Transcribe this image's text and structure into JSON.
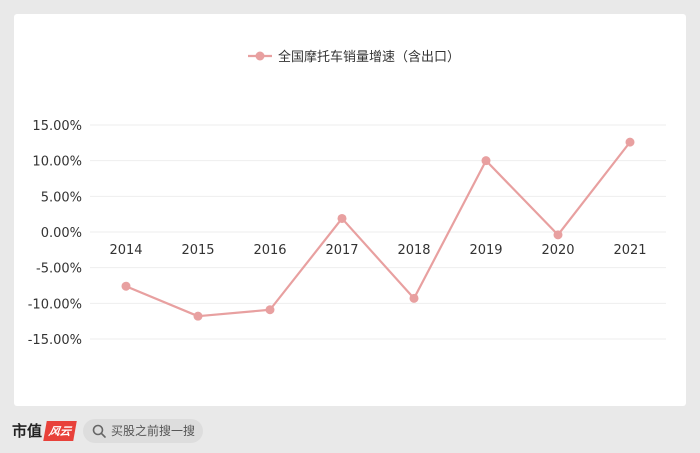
{
  "chart_data": {
    "type": "line",
    "x": [
      "2014",
      "2015",
      "2016",
      "2017",
      "2018",
      "2019",
      "2020",
      "2021"
    ],
    "series": [
      {
        "name": "全国摩托车销量增速（含出口）",
        "values": [
          -7.6,
          -11.8,
          -10.9,
          1.9,
          -9.3,
          10.0,
          -0.4,
          12.6
        ],
        "color": "#e8a0a0"
      }
    ],
    "y_ticks": [
      "15.00%",
      "10.00%",
      "5.00%",
      "0.00%",
      "-5.00%",
      "-10.00%",
      "-15.00%"
    ],
    "ylim": [
      -15,
      15
    ],
    "grid": true,
    "legend": "top-center"
  },
  "footer": {
    "brand": "市值",
    "search_placeholder": "买股之前搜一搜"
  }
}
